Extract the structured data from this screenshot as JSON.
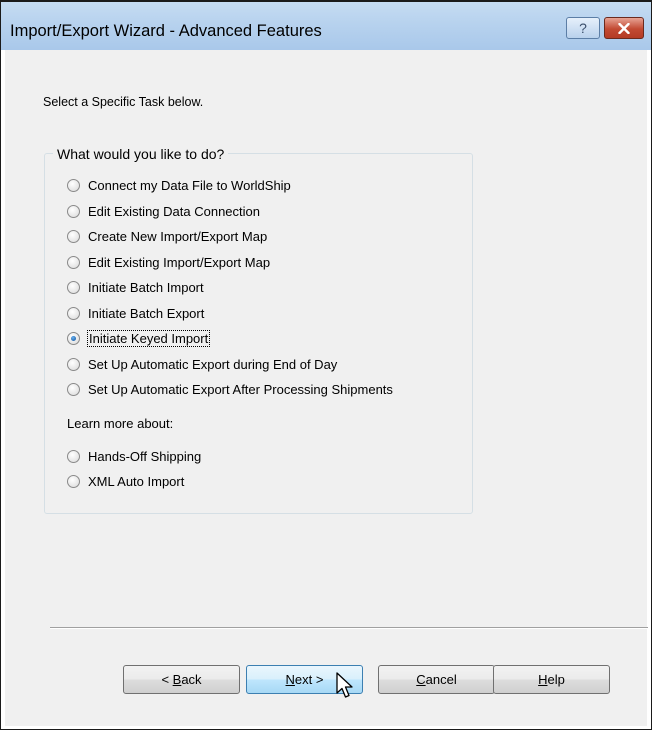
{
  "window": {
    "title": "Import/Export Wizard - Advanced Features",
    "help_glyph": "?",
    "close_glyph": "✕"
  },
  "instruction": "Select a Specific Task below.",
  "group": {
    "label": "What would you like to do?",
    "options": [
      {
        "label": "Connect my Data File to WorldShip",
        "checked": false
      },
      {
        "label": "Edit Existing Data Connection",
        "checked": false
      },
      {
        "label": "Create New Import/Export Map",
        "checked": false
      },
      {
        "label": "Edit Existing Import/Export Map",
        "checked": false
      },
      {
        "label": "Initiate Batch Import",
        "checked": false
      },
      {
        "label": "Initiate Batch Export",
        "checked": false
      },
      {
        "label": "Initiate Keyed Import",
        "checked": true
      },
      {
        "label": "Set Up Automatic Export during End of Day",
        "checked": false
      },
      {
        "label": "Set Up Automatic Export After Processing Shipments",
        "checked": false
      }
    ],
    "learn_more_label": "Learn more about:",
    "learn_options": [
      {
        "label": "Hands-Off Shipping",
        "checked": false
      },
      {
        "label": "XML Auto Import",
        "checked": false
      }
    ]
  },
  "buttons": {
    "back": {
      "prefix": "< ",
      "mnemonic": "B",
      "rest": "ack"
    },
    "next": {
      "mnemonic": "N",
      "rest": "ext >"
    },
    "cancel": {
      "mnemonic": "C",
      "rest": "ancel"
    },
    "help": {
      "mnemonic": "H",
      "rest": "elp"
    }
  }
}
